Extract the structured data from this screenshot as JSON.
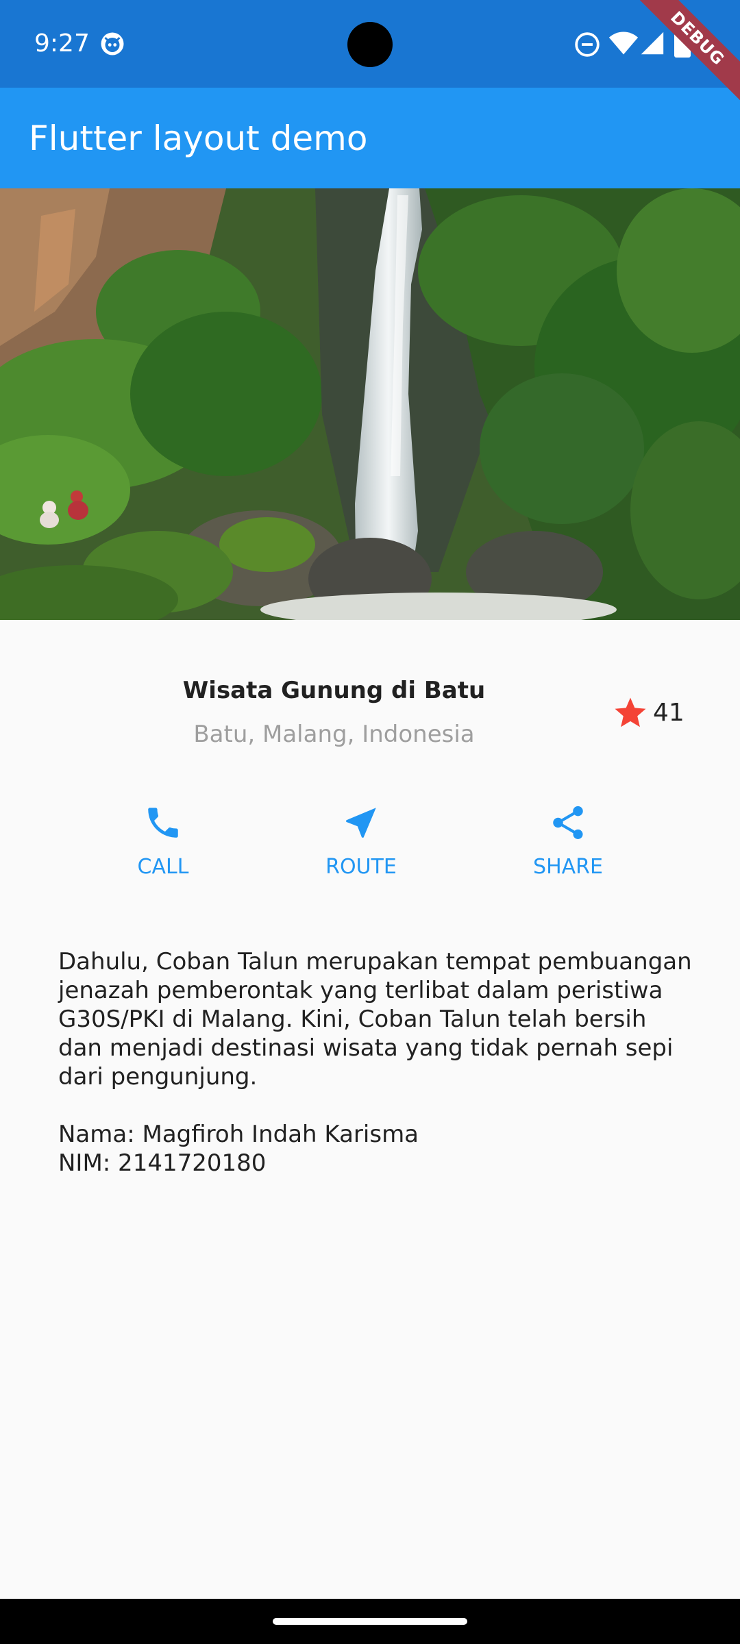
{
  "status_bar": {
    "time": "9:27",
    "icons": [
      "app-notification-icon",
      "do-not-disturb-icon",
      "wifi-icon",
      "cellular-signal-icon",
      "battery-icon"
    ]
  },
  "debug_banner": "DEBUG",
  "app_bar": {
    "title": "Flutter layout demo",
    "color": "#2196f3"
  },
  "hero_image": {
    "subject": "waterfall"
  },
  "title_section": {
    "name": "Wisata Gunung di Batu",
    "location": "Batu, Malang, Indonesia",
    "rating_icon": "star-icon",
    "rating_color": "#f44336",
    "rating_count": "41"
  },
  "buttons": [
    {
      "label": "CALL",
      "icon": "phone-icon"
    },
    {
      "label": "ROUTE",
      "icon": "near-me-icon"
    },
    {
      "label": "SHARE",
      "icon": "share-icon"
    }
  ],
  "accent_color": "#2196f3",
  "description": "Dahulu, Coban Talun merupakan tempat pembuangan jenazah pemberontak yang terlibat dalam peristiwa G30S/PKI di Malang. Kini, Coban Talun telah bersih dan menjadi destinasi wisata yang tidak pernah sepi dari pengunjung.\n\nNama: Magfiroh Indah Karisma\nNIM: 2141720180"
}
